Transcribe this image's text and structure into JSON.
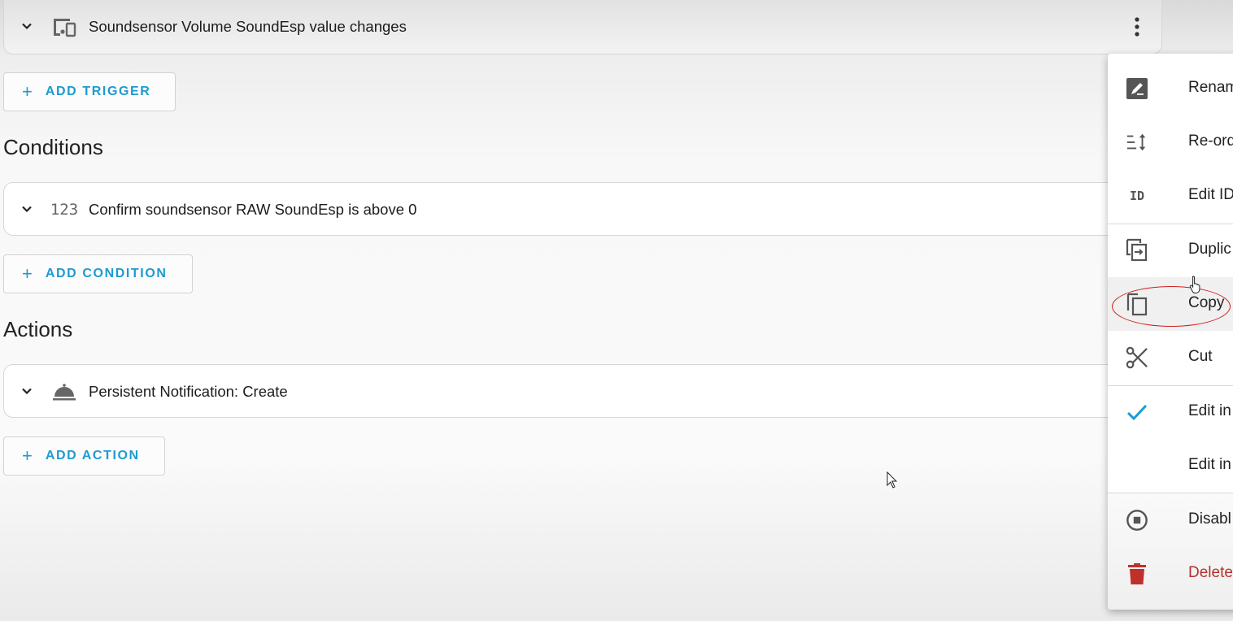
{
  "trigger": {
    "title": "Soundsensor Volume SoundEsp value changes",
    "icon": "devices-icon"
  },
  "buttons": {
    "add_trigger": "ADD TRIGGER",
    "add_condition": "ADD CONDITION",
    "add_action": "ADD ACTION",
    "plus": "+"
  },
  "sections": {
    "conditions": "Conditions",
    "actions": "Actions"
  },
  "condition": {
    "title": "Confirm soundsensor RAW SoundEsp is above 0",
    "icon_text": "123"
  },
  "action": {
    "title": "Persistent Notification: Create",
    "icon": "bell-icon"
  },
  "menu": {
    "items": [
      {
        "label": "Renam",
        "icon": "rename-icon"
      },
      {
        "label": "Re-ord",
        "icon": "reorder-icon"
      },
      {
        "label": "Edit ID",
        "icon": "id-icon"
      },
      {
        "label": "Duplic",
        "icon": "duplicate-icon"
      },
      {
        "label": "Copy",
        "icon": "copy-icon",
        "highlighted": true
      },
      {
        "label": "Cut",
        "icon": "cut-icon"
      },
      {
        "label": "Edit in",
        "icon": "check-icon",
        "checked": true
      },
      {
        "label": "Edit in",
        "icon": ""
      },
      {
        "label": "Disabl",
        "icon": "disable-icon"
      },
      {
        "label": "Delete",
        "icon": "delete-icon",
        "danger": true
      }
    ],
    "id_icon_text": "ID"
  },
  "colors": {
    "accent": "#1d9bd1",
    "danger": "#b3312c",
    "annotation": "#d01e1e"
  }
}
